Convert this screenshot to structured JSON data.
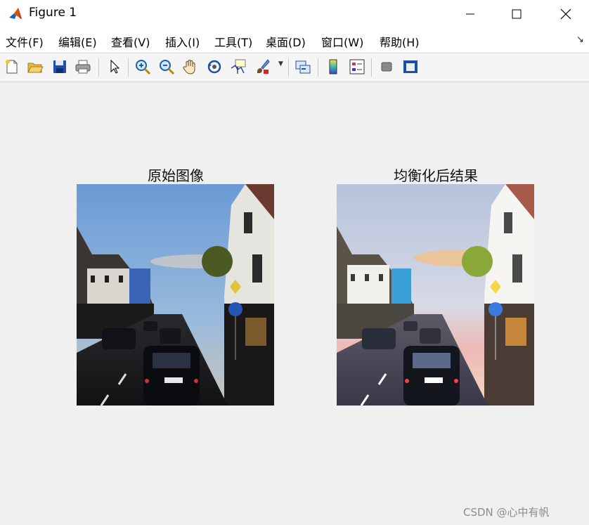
{
  "window": {
    "title": "Figure 1"
  },
  "menu": [
    {
      "label": "文件(F)"
    },
    {
      "label": "编辑(E)"
    },
    {
      "label": "查看(V)"
    },
    {
      "label": "插入(I)"
    },
    {
      "label": "工具(T)"
    },
    {
      "label": "桌面(D)"
    },
    {
      "label": "窗口(W)"
    },
    {
      "label": "帮助(H)"
    }
  ],
  "toolbar": [
    {
      "name": "new-figure-icon"
    },
    {
      "name": "open-file-icon"
    },
    {
      "name": "save-icon"
    },
    {
      "name": "print-icon"
    },
    {
      "name": "edit-plot-arrow-icon"
    },
    {
      "name": "zoom-in-icon"
    },
    {
      "name": "zoom-out-icon"
    },
    {
      "name": "pan-hand-icon"
    },
    {
      "name": "rotate-3d-icon"
    },
    {
      "name": "data-cursor-icon"
    },
    {
      "name": "brush-icon"
    },
    {
      "name": "link-plot-icon"
    },
    {
      "name": "colorbar-icon"
    },
    {
      "name": "legend-icon"
    },
    {
      "name": "hide-plot-tools-icon"
    },
    {
      "name": "show-plot-tools-icon"
    }
  ],
  "axes": [
    {
      "title": "原始图像"
    },
    {
      "title": "均衡化后结果"
    }
  ],
  "watermark": "CSDN @心中有帆"
}
